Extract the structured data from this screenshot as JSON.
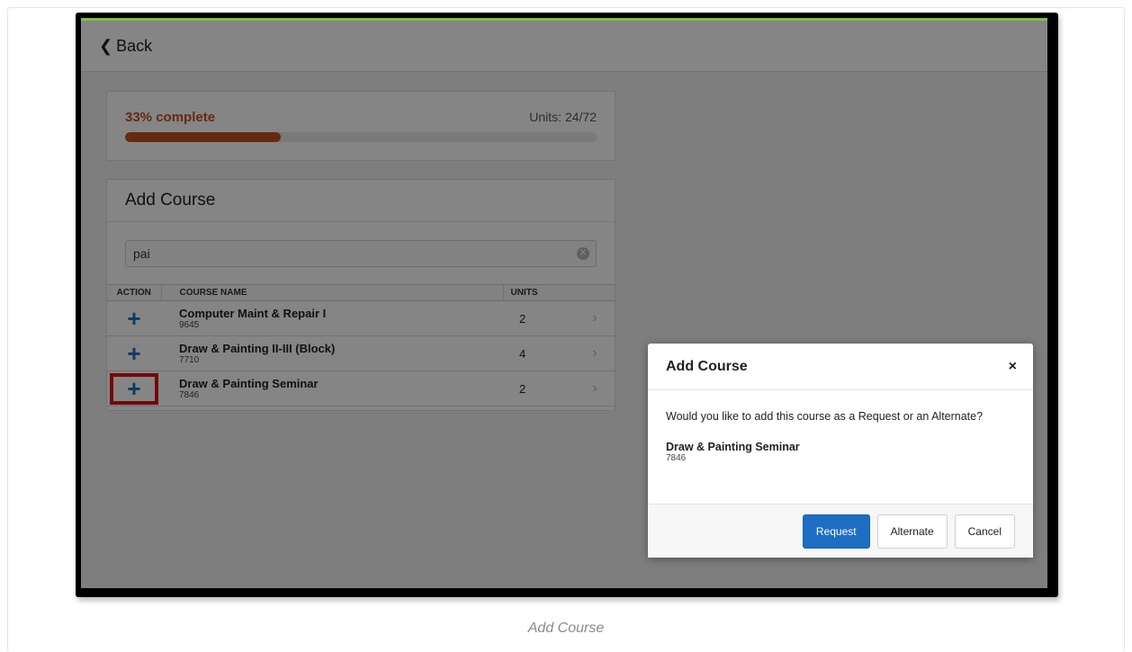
{
  "app": {
    "back_label": "Back"
  },
  "progress": {
    "label": "33% complete",
    "percent": 33,
    "units_label": "Units: 24/72"
  },
  "add_course": {
    "title": "Add Course",
    "search": {
      "value": "pai"
    },
    "table": {
      "headers": [
        "ACTION",
        "COURSE NAME",
        "UNITS"
      ],
      "rows": [
        {
          "name": "Computer Maint & Repair I",
          "code": "9645",
          "units": "2"
        },
        {
          "name": "Draw & Painting II-III (Block)",
          "code": "7710",
          "units": "4"
        },
        {
          "name": "Draw & Painting Seminar",
          "code": "7846",
          "units": "2"
        }
      ],
      "highlighted_row": 2
    }
  },
  "modal": {
    "title": "Add Course",
    "close_glyph": "×",
    "question": "Would you like to add this course as a Request or an Alternate?",
    "course_name": "Draw & Painting Seminar",
    "course_code": "7846",
    "buttons": {
      "request": "Request",
      "alternate": "Alternate",
      "cancel": "Cancel"
    }
  },
  "icons": {
    "back": "chevron-left-icon",
    "add": "plus-icon",
    "row_arrow": "chevron-right-icon",
    "clear": "clear-circle-icon",
    "close": "close-icon"
  },
  "colors": {
    "accent_green": "#7dc243",
    "progress": "#c2521e",
    "primary": "#1d6ec2",
    "highlight_red": "#e01010"
  },
  "caption": "Add Course"
}
